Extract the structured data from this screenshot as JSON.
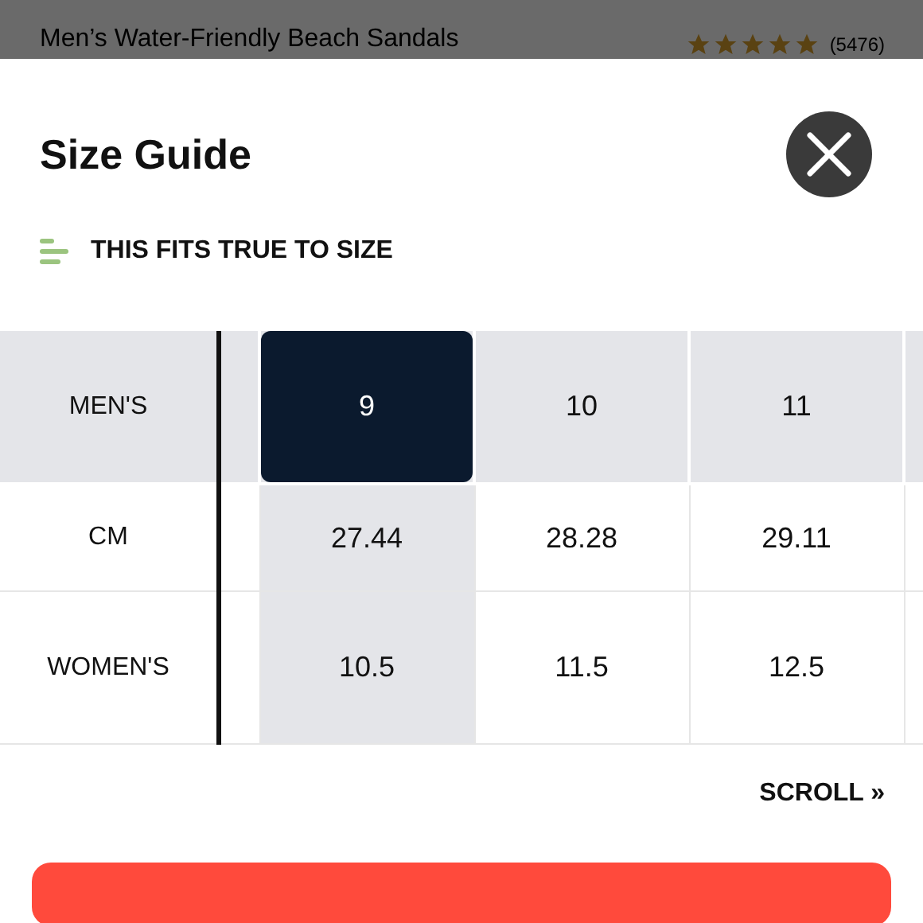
{
  "product": {
    "subtitle": "Men’s Water-Friendly Beach Sandals",
    "stars": 5,
    "review_count": "(5476)"
  },
  "size_guide": {
    "title": "Size Guide",
    "fit_note": "THIS FITS TRUE TO SIZE"
  },
  "table": {
    "header_label": "MEN'S",
    "sizes": [
      {
        "label": "9",
        "selected": true
      },
      {
        "label": "10",
        "selected": false
      },
      {
        "label": "11",
        "selected": false
      }
    ],
    "rows": [
      {
        "label": "CM",
        "cells": [
          "27.44",
          "28.28",
          "29.11"
        ]
      },
      {
        "label": "WOMEN'S",
        "cells": [
          "10.5",
          "11.5",
          "12.5"
        ]
      }
    ]
  },
  "scroll_hint": "SCROLL »"
}
